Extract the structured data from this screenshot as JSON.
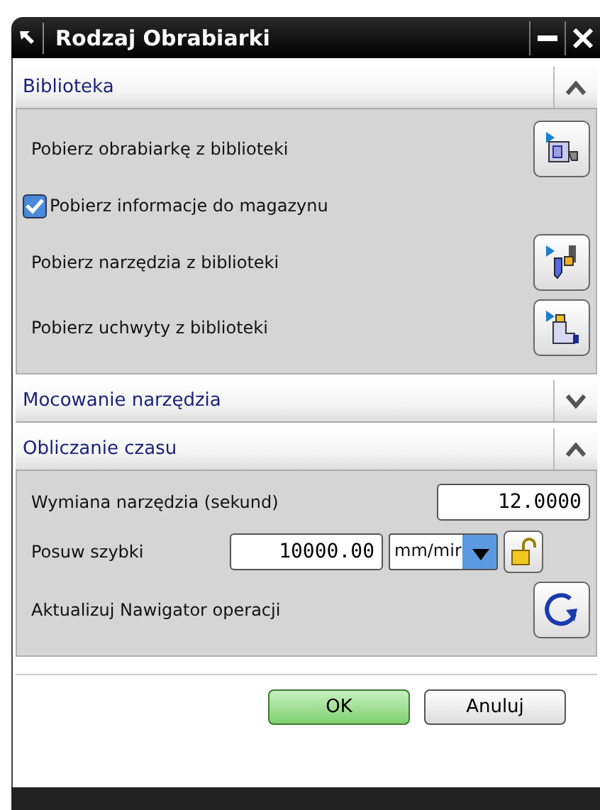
{
  "window": {
    "title": "Rodzaj Obrabiarki"
  },
  "sections": [
    {
      "title": "Biblioteka",
      "expanded": true,
      "rows": [
        {
          "kind": "action",
          "label": "Pobierz obrabiarkę z biblioteki"
        },
        {
          "kind": "checkbox",
          "label": "Pobierz informacje do magazynu",
          "checked": true
        },
        {
          "kind": "action",
          "label": "Pobierz narzędzia z biblioteki"
        },
        {
          "kind": "action",
          "label": "Pobierz uchwyty z biblioteki"
        }
      ]
    },
    {
      "title": "Mocowanie narzędzia",
      "expanded": false
    },
    {
      "title": "Obliczanie czasu",
      "expanded": true,
      "rows": [
        {
          "kind": "number",
          "label": "Wymiana narzędzia (sekund)",
          "value": "12.0000"
        },
        {
          "kind": "feed",
          "label": "Posuw szybki",
          "value": "10000.00",
          "unit": "mm/mir",
          "locked": false
        },
        {
          "kind": "action",
          "label": "Aktualizuj Nawigator operacji"
        }
      ]
    }
  ],
  "buttons": [
    {
      "label": "OK",
      "default": true
    },
    {
      "label": "Anuluj",
      "default": false
    }
  ]
}
